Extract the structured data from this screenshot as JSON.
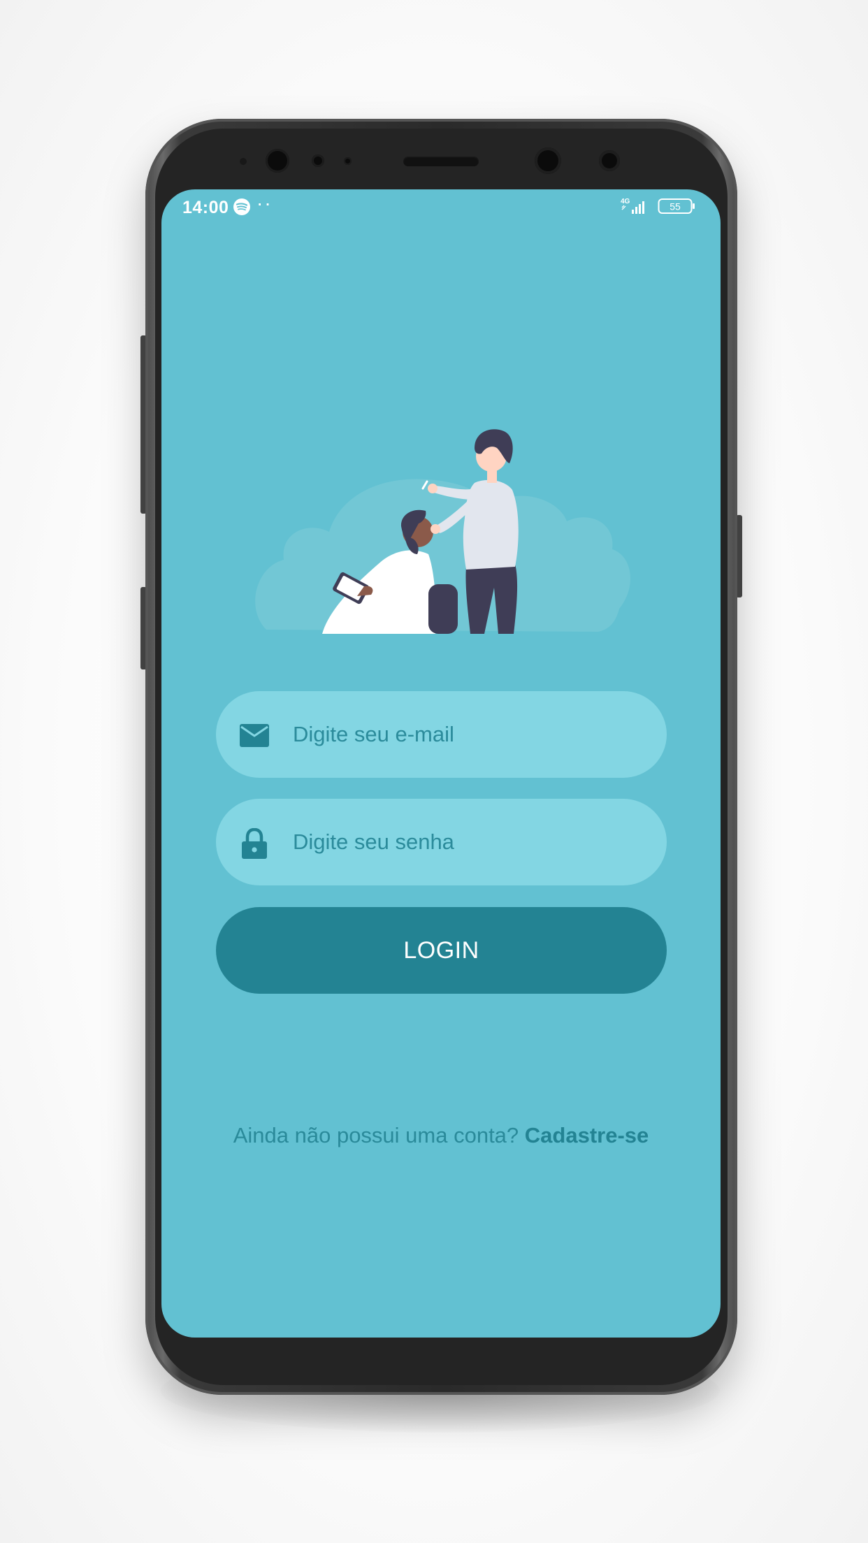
{
  "status_bar": {
    "time": "14:00",
    "dots": "··",
    "network": "4G",
    "battery": "55"
  },
  "colors": {
    "screen_bg": "#62c1d2",
    "field_bg": "#83d6e3",
    "accent": "#238393",
    "text": "#2a8a9a"
  },
  "illustration": {
    "icon": "barber-illustration"
  },
  "login_form": {
    "email_placeholder": "Digite seu e-mail",
    "email_icon": "envelope-icon",
    "password_placeholder": "Digite seu senha",
    "password_icon": "lock-icon",
    "login_label": "LOGIN"
  },
  "signup": {
    "prompt": "Ainda não possui uma conta?",
    "link_label": "Cadastre-se"
  }
}
